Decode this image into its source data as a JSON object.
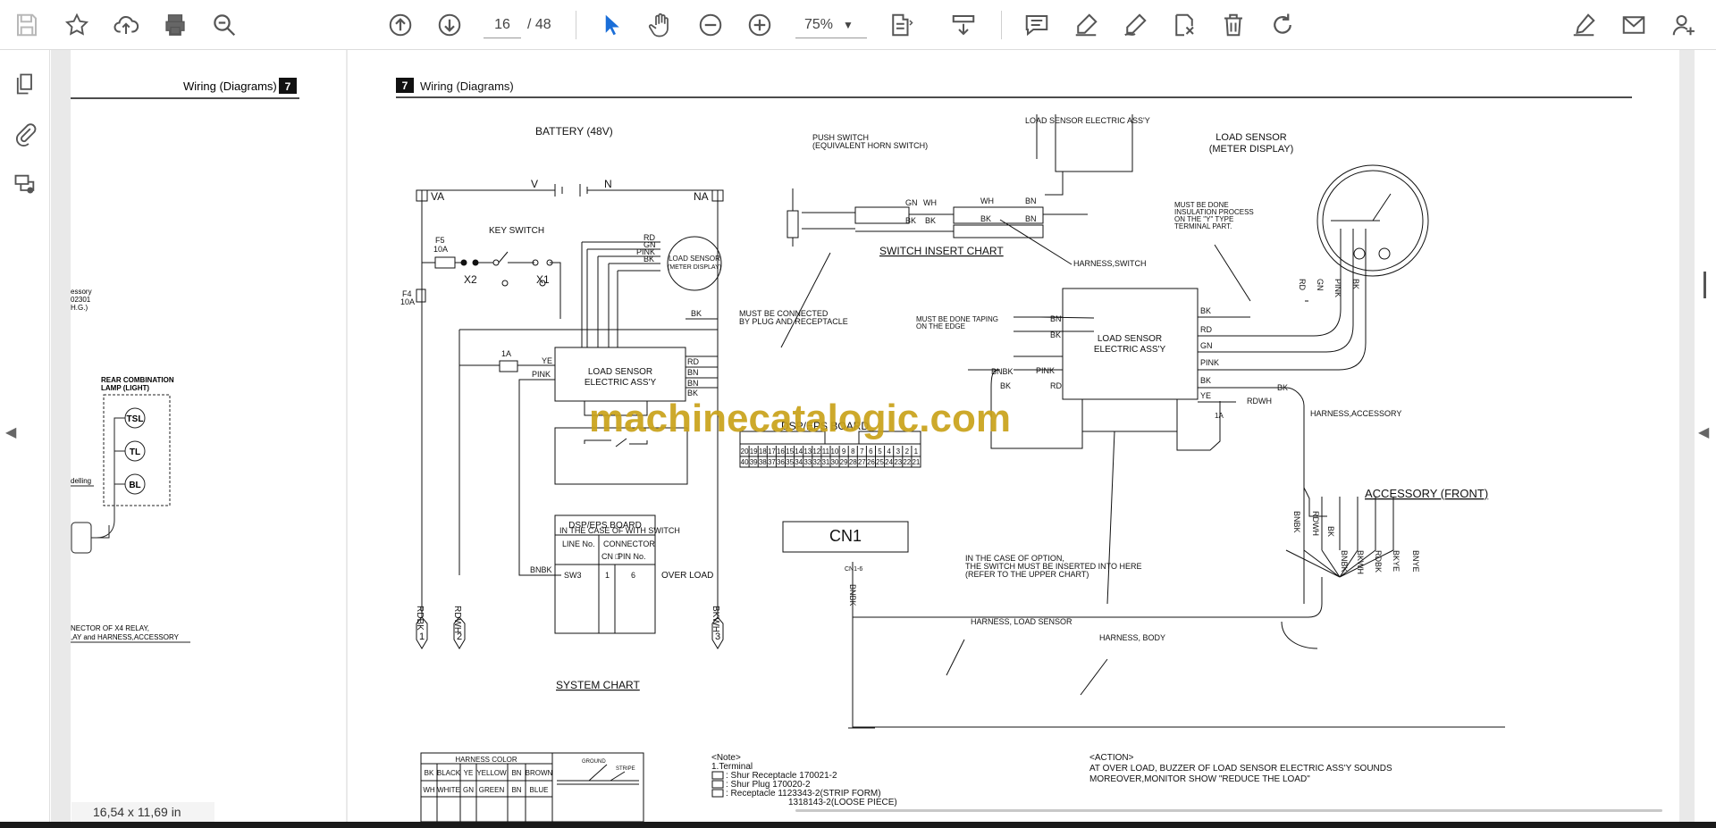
{
  "toolbar": {
    "page_current": "16",
    "page_separator": "/",
    "page_total": "48",
    "zoom": "75%",
    "icons": [
      "save-icon",
      "bookmark-star-icon",
      "upload-cloud-icon",
      "print-icon",
      "zoom-search-icon",
      "page-up-icon",
      "page-down-icon",
      "select-arrow-icon",
      "hand-icon",
      "zoom-out-icon",
      "zoom-in-icon",
      "fit-page-icon",
      "scroll-mode-icon",
      "comment-icon",
      "highlight-icon",
      "draw-icon",
      "stamp-icon",
      "delete-icon",
      "undo-icon",
      "sign-icon",
      "email-icon",
      "share-user-icon"
    ]
  },
  "sidebar": {
    "icons": [
      "pages-thumbnail-icon",
      "attachments-icon",
      "layers-icon"
    ]
  },
  "status": {
    "page_size": "16,54 x 11,69 in"
  },
  "watermark": "machinecatalogic.com",
  "left_page": {
    "header_title": "Wiring (Diagrams)",
    "header_number": "7",
    "frag1": "essory",
    "frag2": "02301",
    "frag3": "H.G.)",
    "rear_lamp_title_1": "REAR COMBINATION",
    "rear_lamp_title_2": "LAMP (LIGHT)",
    "lamp_tsl": "TSL",
    "lamp_tl": "TL",
    "lamp_bl": "BL",
    "frag_deling": "delling",
    "connector_note_1": "NECTOR OF X4 RELAY,",
    "connector_note_2": ",AY and HARNESS,ACCESSORY"
  },
  "main_page": {
    "header_number": "7",
    "header_title": "Wiring (Diagrams)",
    "battery_label": "BATTERY (48V)",
    "v_label": "V",
    "n_label": "N",
    "va_label": "VA",
    "na_label": "NA",
    "f5_label": "F5",
    "f5_rating": "10A",
    "f4_label": "F4",
    "f4_rating": "10A",
    "key_switch": "KEY SWITCH",
    "x2": "X2",
    "x1": "X1",
    "fuse_1a": "1A",
    "ye": "YE",
    "pink": "PINK",
    "rd": "RD",
    "gn": "GN",
    "bk": "BK",
    "bn": "BN",
    "load_sensor_meter_1": "LOAD SENSOR",
    "load_sensor_meter_2": "(METER DISPLAY)",
    "lse_1": "LOAD SENSOR",
    "lse_2": "ELECTRIC ASS'Y",
    "with_switch": "IN THE CASE OF WITH SWITCH",
    "dsp_title": "DSP/EPS BOARD",
    "line_no": "LINE No.",
    "connector": "CONNECTOR",
    "cn_col": "CN □",
    "pin_col": "PIN No.",
    "sw3": "SW3",
    "cn_val": "1",
    "pin_val": "6",
    "over_load": "OVER LOAD",
    "bnbk": "BNBK",
    "system_chart": "SYSTEM CHART",
    "rdbk": "RDBK",
    "rdwh": "RDWH",
    "bkwh": "BKWH",
    "term1": "1",
    "term2": "2",
    "term3": "3",
    "push_switch_1": "PUSH SWITCH",
    "push_switch_2": "(EQUIVALENT HORN SWITCH)",
    "wh": "WH",
    "switch_insert_chart": "SWITCH INSERT CHART",
    "lse_top": "LOAD SENSOR ELECTRIC ASS'Y",
    "harness_switch": "HARNESS,SWITCH",
    "must_connected_1": "MUST BE CONNECTED",
    "must_connected_2": "BY PLUG AND RECEPTACLE",
    "dsp_eps_board_label": "DSP/EPS BOARD",
    "pins_top": [
      "20",
      "19",
      "18",
      "17",
      "16",
      "15",
      "14",
      "13",
      "12",
      "11",
      "10",
      "9",
      "8",
      "7",
      "6",
      "5",
      "4",
      "3",
      "2",
      "1"
    ],
    "pins_bottom": [
      "40",
      "39",
      "38",
      "37",
      "36",
      "35",
      "34",
      "33",
      "32",
      "31",
      "30",
      "29",
      "28",
      "27",
      "26",
      "25",
      "24",
      "23",
      "22",
      "21"
    ],
    "cn1": "CN1",
    "cn1_6": "CN1-6",
    "meter_title_1": "LOAD SENSOR",
    "meter_title_2": "(METER DISPLAY)",
    "insulation_1": "MUST BE DONE",
    "insulation_2": "INSULATION PROCESS",
    "insulation_3": "ON THE \"Y\" TYPE",
    "insulation_4": "TERMINAL PART.",
    "taping_1": "MUST BE DONE TAPING",
    "taping_2": "ON THE EDGE",
    "rdwh_small": "RDWH",
    "harness_accessory": "HARNESS,ACCESSORY",
    "accessory_front": "ACCESSORY (FRONT)",
    "option_1": "IN THE CASE OF OPTION,",
    "option_2": "THE SWITCH MUST BE INSERTED INTO HERE",
    "option_3": "(REFER TO THE UPPER CHART)",
    "harness_load_sensor": "HARNESS, LOAD SENSOR",
    "harness_body": "HARNESS, BODY",
    "bkwh_small": "BKWH",
    "bkye": "BKYE",
    "bnye": "BNYE",
    "harness_color_title": "HARNESS COLOR",
    "harness_colors": [
      [
        "BK",
        "BLACK",
        "YE",
        "YELLOW",
        "BN",
        "BROWN"
      ],
      [
        "WH",
        "WHITE",
        "GN",
        "GREEN",
        "BN",
        "BLUE"
      ]
    ],
    "ground_label": "GROUND",
    "stripe_label": "STRIPE",
    "note_title": "<Note>",
    "note_1": "1.Terminal",
    "note_shur_rec": ": Shur Receptacle 170021-2",
    "note_shur_plug": ": Shur Plug        170020-2",
    "note_receptacle": ": Receptacle       1123343-2(STRIP FORM)",
    "note_receptacle_2": "1318143-2(LOOSE PIECE)",
    "action_title": "<ACTION>",
    "action_1": "AT OVER LOAD, BUZZER OF LOAD SENSOR ELECTRIC ASS'Y SOUNDS",
    "action_2": "MOREOVER,MONITOR SHOW \"REDUCE THE LOAD\""
  },
  "colors": {
    "watermark": "#c9a21a",
    "select_tool": "#1a6ed8",
    "header_box": "#111111"
  }
}
